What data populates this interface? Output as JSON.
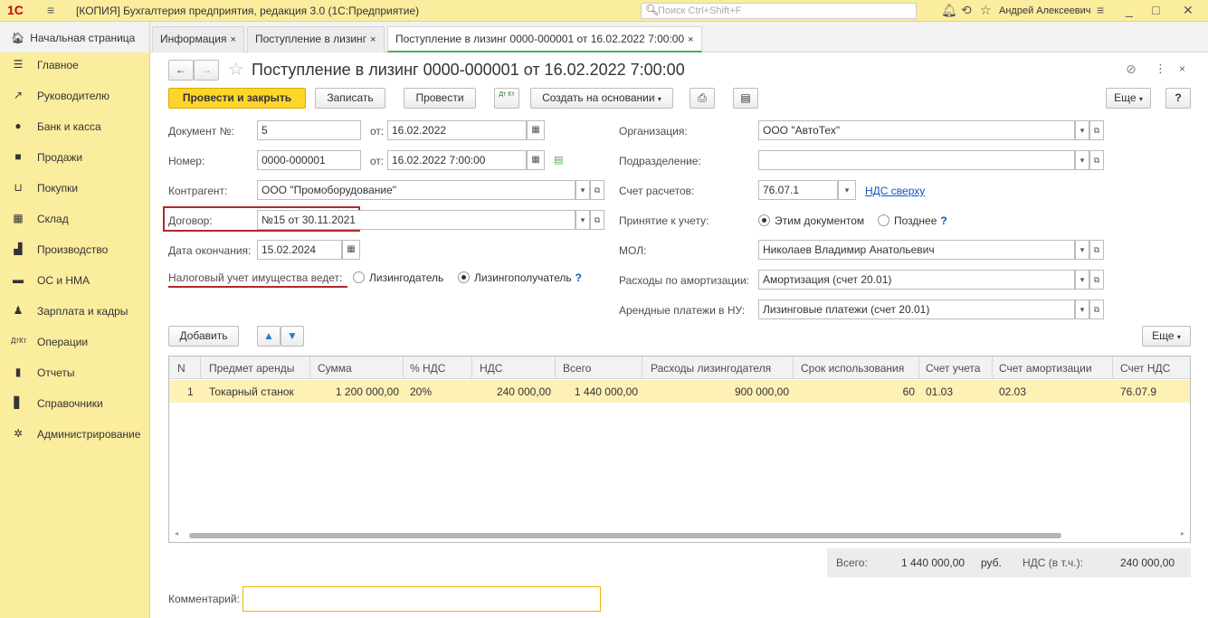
{
  "titlebar": {
    "logo": "1С",
    "title": "[КОПИЯ] Бухгалтерия предприятия, редакция 3.0  (1С:Предприятие)",
    "search_placeholder": "Поиск Ctrl+Shift+F",
    "user": "Андрей Алексеевич"
  },
  "tabs": {
    "home": "Начальная страница",
    "items": [
      {
        "label": "Информация"
      },
      {
        "label": "Поступление в лизинг"
      },
      {
        "label": "Поступление в лизинг 0000-000001 от 16.02.2022 7:00:00"
      }
    ]
  },
  "sidebar": {
    "items": [
      {
        "label": "Главное",
        "icon": "menu-icon"
      },
      {
        "label": "Руководителю",
        "icon": "trend-icon"
      },
      {
        "label": "Банк и касса",
        "icon": "coin-icon"
      },
      {
        "label": "Продажи",
        "icon": "bag-icon"
      },
      {
        "label": "Покупки",
        "icon": "cart-icon"
      },
      {
        "label": "Склад",
        "icon": "warehouse-icon"
      },
      {
        "label": "Производство",
        "icon": "factory-icon"
      },
      {
        "label": "ОС и НМА",
        "icon": "truck-icon"
      },
      {
        "label": "Зарплата и кадры",
        "icon": "person-icon"
      },
      {
        "label": "Операции",
        "icon": "dtkt-icon"
      },
      {
        "label": "Отчеты",
        "icon": "bar-chart-icon"
      },
      {
        "label": "Справочники",
        "icon": "book-icon"
      },
      {
        "label": "Администрирование",
        "icon": "gear-icon"
      }
    ]
  },
  "doc": {
    "title": "Поступление в лизинг 0000-000001 от 16.02.2022 7:00:00",
    "toolbar": {
      "post_close": "Провести и закрыть",
      "save": "Записать",
      "post": "Провести",
      "dtkt": "Дт Кт",
      "create_based": "Создать на основании",
      "more": "Еще",
      "help": "?"
    },
    "fields": {
      "doc_no_label": "Документ №:",
      "doc_no": "5",
      "from_label": "от:",
      "doc_date": "16.02.2022",
      "number_label": "Номер:",
      "number": "0000-000001",
      "number_date": "16.02.2022  7:00:00",
      "contractor_label": "Контрагент:",
      "contractor": "ООО \"Промоборудование\"",
      "contract_label": "Договор:",
      "contract": "№15 от 30.11.2021",
      "end_date_label": "Дата окончания:",
      "end_date": "15.02.2024",
      "tax_label": "Налоговый учет имущества ведет:",
      "tax_opt1": "Лизингодатель",
      "tax_opt2": "Лизингополучатель",
      "org_label": "Организация:",
      "org": "ООО \"АвтоТех\"",
      "dept_label": "Подразделение:",
      "dept": "",
      "account_label": "Счет расчетов:",
      "account": "76.07.1",
      "vat_link": "НДС сверху",
      "accept_label": "Принятие к учету:",
      "accept_opt1": "Этим документом",
      "accept_opt2": "Позднее",
      "mol_label": "МОЛ:",
      "mol": "Николаев Владимир Анатольевич",
      "depr_label": "Расходы по амортизации:",
      "depr": "Амортизация (счет 20.01)",
      "lease_label": "Арендные платежи в НУ:",
      "lease": "Лизинговые платежи (счет 20.01)",
      "q": "?"
    },
    "table_toolbar": {
      "add": "Добавить",
      "more": "Еще"
    },
    "table": {
      "headers": [
        "N",
        "Предмет аренды",
        "Сумма",
        "% НДС",
        "НДС",
        "Всего",
        "Расходы лизингодателя",
        "Срок использования",
        "Счет учета",
        "Счет амортизации",
        "Счет НДС"
      ],
      "rows": [
        [
          "1",
          "Токарный станок",
          "1 200 000,00",
          "20%",
          "240 000,00",
          "1 440 000,00",
          "900 000,00",
          "60",
          "01.03",
          "02.03",
          "76.07.9"
        ]
      ]
    },
    "totals": {
      "total_label": "Всего:",
      "total": "1 440 000,00",
      "currency": "руб.",
      "vat_label": "НДС (в т.ч.):",
      "vat": "240 000,00"
    },
    "comment_label": "Комментарий:",
    "comment": ""
  }
}
